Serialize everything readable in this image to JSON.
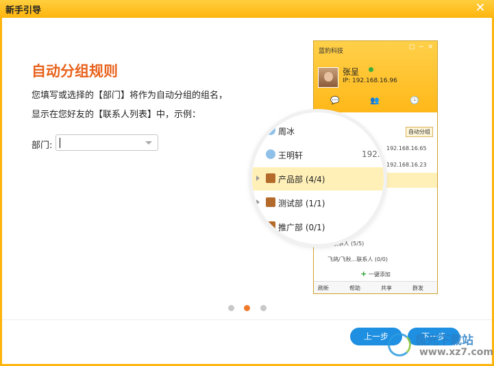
{
  "window": {
    "title": "新手引导",
    "close_glyph": "✕"
  },
  "content": {
    "heading": "自动分组规则",
    "desc_line1": "您填写或选择的【部门】将作为自动分组的组名，",
    "desc_line2": "显示在您好友的【联系人列表】中，示例：",
    "dept_label": "部门:",
    "dept_value": ""
  },
  "preview": {
    "app_name": "蓝豹科技",
    "win_buttons": "□ ─ ✕",
    "user_name": "张呈",
    "ip": "IP: 192.168.16.96",
    "tabs": [
      "💬",
      "👥",
      "🕒"
    ],
    "list": [
      {
        "text": "...系人...",
        "ip": ""
      },
      {
        "text": "",
        "ip": "192.168.16.65"
      },
      {
        "text": "",
        "ip": "192.168.16.23"
      }
    ],
    "auto_group_button": "自动分组",
    "group_row": "...联系人 (5/5)",
    "group_row2": "飞鸽/飞秋...联系人 (0/0)",
    "add_label": "一键添加",
    "bottom": [
      "刷新",
      "帮助",
      "共享",
      "群发"
    ]
  },
  "lens": {
    "rows": [
      {
        "text": "周冰",
        "ip": "",
        "icon": "person-icon"
      },
      {
        "text": "王明轩",
        "ip": "192.",
        "icon": "person-icon"
      },
      {
        "text": "产品部 (4/4)",
        "ip": "",
        "icon": "book-icon"
      },
      {
        "text": "测试部 (1/1)",
        "ip": "",
        "icon": "book-icon"
      },
      {
        "text": "推广部 (0/1)",
        "ip": "",
        "icon": "book-icon"
      }
    ]
  },
  "pager": {
    "pages": 3,
    "current": 2
  },
  "buttons": {
    "prev": "上一步",
    "next": "下一步"
  },
  "watermark": {
    "top": "极光下载站",
    "url": "www.xz7.com"
  },
  "colors": {
    "accent": "#ffb40c",
    "heading": "#e8621c",
    "button": "#1e8fe1",
    "active_dot": "#ef7a2b"
  }
}
